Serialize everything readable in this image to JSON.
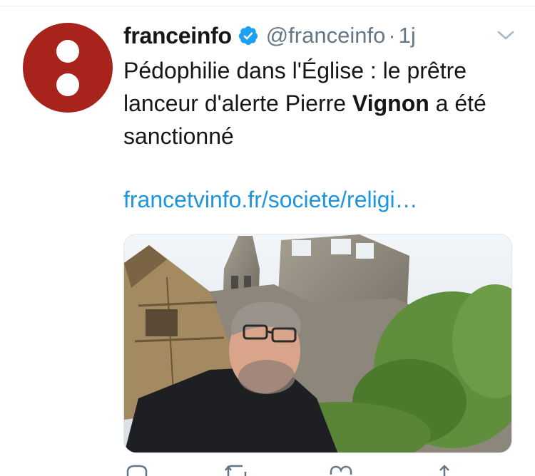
{
  "tweet": {
    "display_name": "franceinfo",
    "handle": "@franceinfo",
    "separator": "·",
    "timestamp": "1j",
    "text_part1": "Pédophilie dans l'Église : le prêtre lanceur d'alerte Pierre ",
    "text_bold": "Vignon",
    "text_part2": " a été sanctionné",
    "link": "francetvinfo.fr/societe/religi…"
  },
  "colors": {
    "avatar_bg": "#a8231c",
    "verified": "#1da1f2",
    "link": "#1b95e0",
    "secondary_text": "#657786"
  },
  "icons": {
    "avatar": "franceinfo-logo",
    "verified": "verified-badge-icon",
    "menu": "chevron-down-icon",
    "actions": [
      "reply-icon",
      "retweet-icon",
      "like-icon",
      "share-icon"
    ]
  }
}
